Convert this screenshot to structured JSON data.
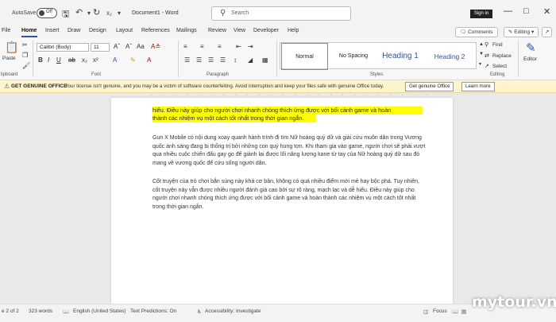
{
  "titlebar": {
    "autosave_label": "AutoSave",
    "autosave_state": "Off",
    "document_title": "Document1 - Word",
    "search_placeholder": "Search",
    "signin_label": "Sign in"
  },
  "menu": {
    "tabs": [
      "File",
      "Home",
      "Insert",
      "Draw",
      "Design",
      "Layout",
      "References",
      "Mailings",
      "Review",
      "View",
      "Developer",
      "Help"
    ],
    "active_tab": "Home",
    "comments_label": "Comments",
    "editing_label": "Editing"
  },
  "ribbon": {
    "clipboard": {
      "paste_label": "Paste",
      "group_label": "lipboard"
    },
    "font": {
      "name": "Calibri (Body)",
      "size": "11",
      "group_label": "Font"
    },
    "paragraph": {
      "group_label": "Paragraph"
    },
    "styles": {
      "items": [
        "Normal",
        "No Spacing",
        "Heading 1",
        "Heading 2"
      ],
      "group_label": "Styles"
    },
    "editing": {
      "find_label": "Find",
      "replace_label": "Replace",
      "select_label": "Select",
      "group_label": "Editing"
    },
    "editor": {
      "label": "Editor"
    }
  },
  "message_bar": {
    "title": "GET GENUINE OFFICE",
    "text": "Your license isn't genuine, and you may be a victim of software counterfeiting. Avoid interruption and keep your files safe with genuine Office today.",
    "primary_button": "Get genuine Office",
    "secondary_button": "Learn more"
  },
  "document": {
    "highlighted_line1": "hiểu. Điều này giúp cho người chơi nhanh chóng thích ứng được với bối cảnh game và hoàn",
    "highlighted_line2": "thành các nhiệm vụ một cách tốt nhất trong thời gian ngắn.",
    "paragraph1": "Gun X Mobile có nội dung xoay quanh hành trình đi tìm Nữ hoàng quỷ dữ và giải cứu muôn dân trong Vương quốc ánh sáng đang bị thống trị bởi những con quỷ hung tợn. Khi tham gia vào game, người chơi sẽ phải vượt qua nhiều cuộc chiến đấu gay go để giành lại được lõi năng lượng kane từ tay của Nữ hoàng quỷ dữ sau đó mang về vương quốc để cứu sống người dân.",
    "paragraph2": "Cốt truyện của trò chơi bắn súng này khá cơ bản, không có quá nhiều điểm mới mẻ hay bộc phá. Tuy nhiên, cốt truyện này vẫn được nhiều người đánh giá cao bởi sự rõ ràng, mạch lạc và dễ hiểu. Điều này giúp cho người chơi nhanh chóng thích ứng được với bối cảnh game và hoàn thành các nhiệm vụ một cách tốt nhất trong thời gian ngắn."
  },
  "status": {
    "page": "e 2 of 2",
    "words": "323 words",
    "language": "English (United States)",
    "text_predictions": "Text Predictions: On",
    "accessibility": "Accessibility: Investigate",
    "focus": "Focus"
  },
  "watermark": "mytour.vn"
}
